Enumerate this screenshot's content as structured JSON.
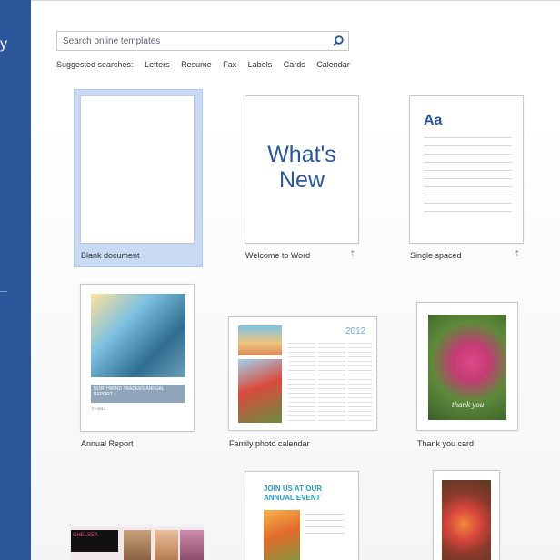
{
  "sidebar": {
    "glyph": "y"
  },
  "search": {
    "placeholder": "Search online templates"
  },
  "suggested": {
    "label": "Suggested searches:",
    "items": [
      "Letters",
      "Resume",
      "Fax",
      "Labels",
      "Cards",
      "Calendar"
    ]
  },
  "templates": [
    {
      "label": "Blank document"
    },
    {
      "label": "Welcome to Word",
      "preview_text": "What's New"
    },
    {
      "label": "Single spaced",
      "preview_text": "Aa"
    },
    {
      "label": "Annual Report",
      "preview_text": "NORTHWIND TRADERS ANNUAL REPORT",
      "preview_sub": "FY 2012"
    },
    {
      "label": "Family photo calendar",
      "preview_text": "2012"
    },
    {
      "label": "Thank you card",
      "preview_text": "thank you"
    },
    {
      "label": "",
      "preview_text": "JOIN US AT OUR ANNUAL EVENT"
    },
    {
      "label": ""
    },
    {
      "label": "",
      "preview_text": "CHELSEA"
    }
  ],
  "colors": {
    "accent": "#2b579a",
    "selected": "#c9daf4"
  }
}
